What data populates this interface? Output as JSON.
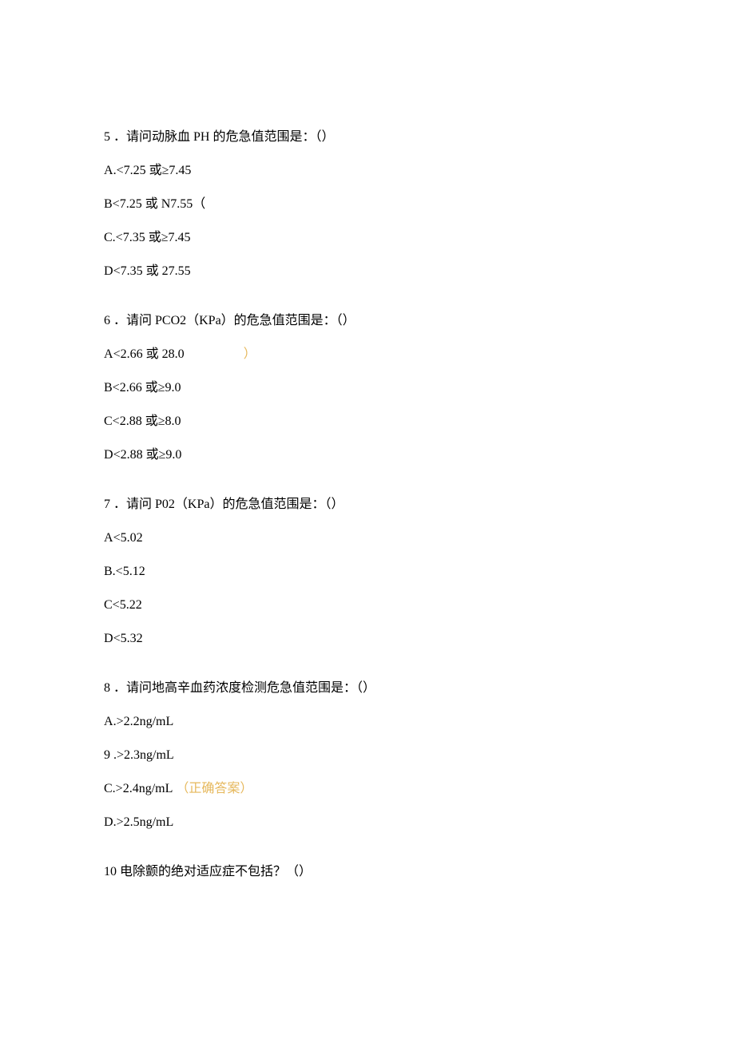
{
  "q5": {
    "num": "5",
    "stem": "．请问动脉血 PH 的危急值范围是：（）",
    "optA_label": "A",
    "optA_text": ".<7.25 或≥7.45",
    "optB_label": "B",
    "optB_text": "<7.25 或 N7.55（",
    "optC_label": "C",
    "optC_text": ".<7.35 或≥7.45",
    "optD_label": "D",
    "optD_text": "<7.35 或 27.55"
  },
  "q6": {
    "num": "6",
    "stem": "．请问 PCO2（KPa）的危急值范围是：（）",
    "optA_label": "A",
    "optA_text": "<2.66 或 28.0",
    "optA_paren": "）",
    "optB_label": "B",
    "optB_text": "<2.66 或≥9.0",
    "optC_label": "C",
    "optC_text": "<2.88 或≥8.0",
    "optD_label": "D",
    "optD_text": "<2.88 或≥9.0"
  },
  "q7": {
    "num": "7",
    "stem": "．请问 P02（KPa）的危急值范围是：（）",
    "optA_label": "A",
    "optA_text": "<5.02",
    "optB_label": "B",
    "optB_text": ".<5.12",
    "optC_label": "C",
    "optC_text": "<5.22",
    "optD_label": "D",
    "optD_text": "<5.32"
  },
  "q8": {
    "num": "8",
    "stem": "．请问地高辛血药浓度检测危急值范围是：（）",
    "optA_label": "A",
    "optA_text": ".>2.2ng/mL",
    "optB_label": "9",
    "optB_text": " .>2.3ng/mL",
    "optC_label": "C",
    "optC_text": ".>2.4ng/mL",
    "optC_correct": "（正确答案）",
    "optD_label": "D",
    "optD_text": ".>2.5ng/mL"
  },
  "q10": {
    "num": "10",
    "stem": " 电除颤的绝对适应症不包括？（）"
  }
}
